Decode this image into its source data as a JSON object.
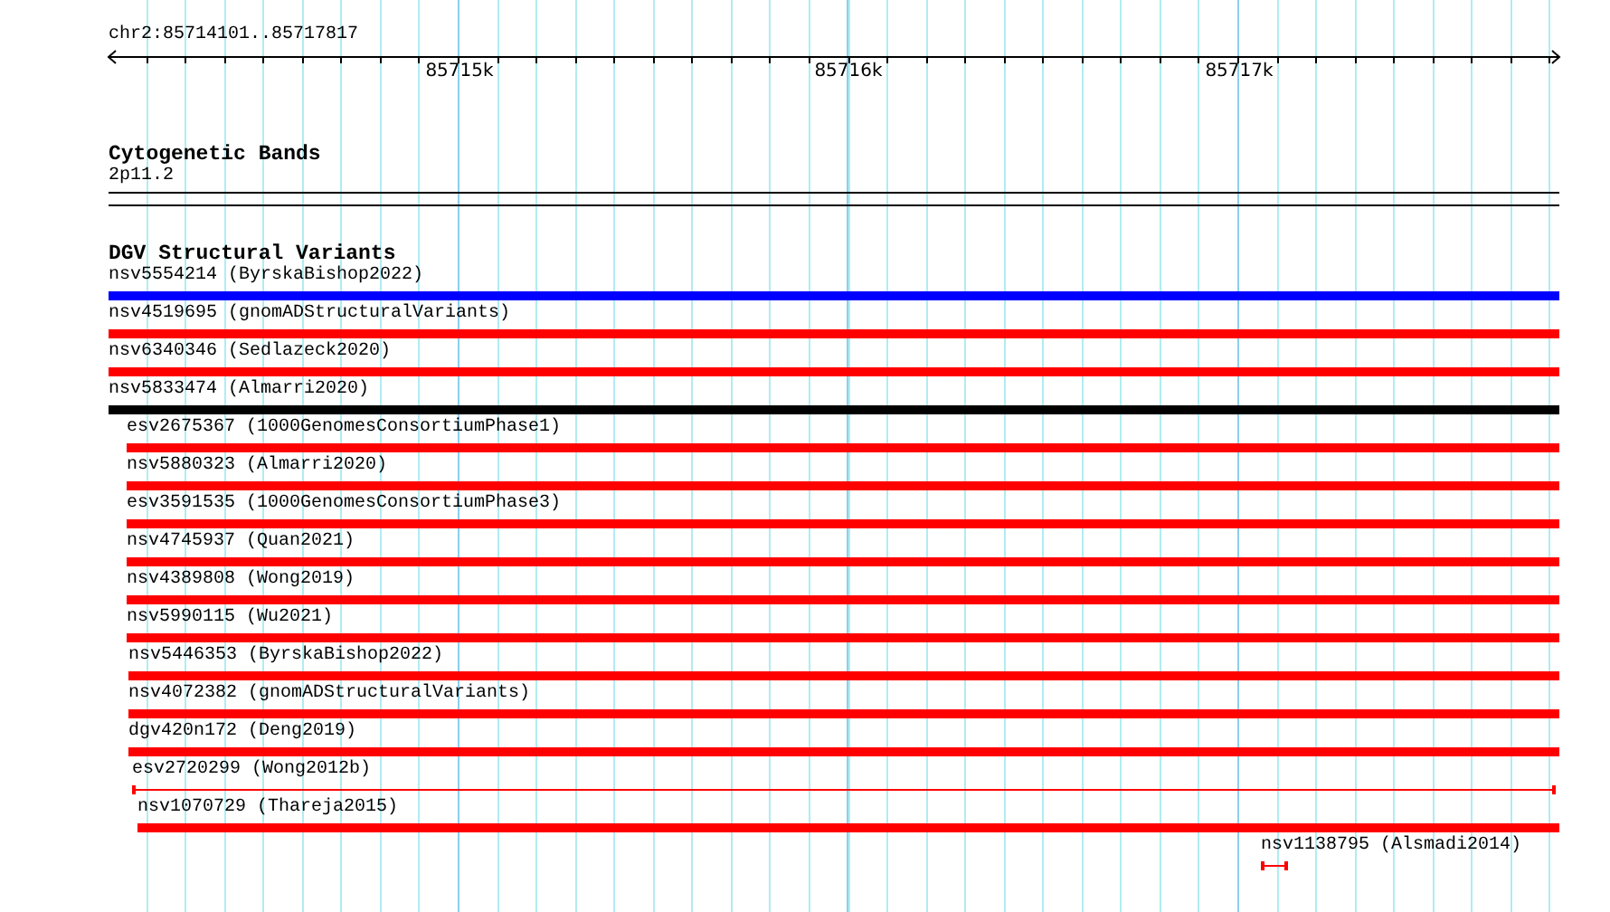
{
  "location": "chr2:85714101..85717817",
  "ruler": {
    "ticks": [
      "85715k",
      "85716k",
      "85717k"
    ]
  },
  "cytoband_track": {
    "title": "Cytogenetic Bands",
    "band": "2p11.2"
  },
  "variant_track": {
    "title": "DGV Structural Variants",
    "features": [
      {
        "label": "nsv5554214 (ByrskaBishop2022)",
        "color": "#0000ff",
        "kind": "bar"
      },
      {
        "label": "nsv4519695 (gnomADStructuralVariants)",
        "color": "#ff0000",
        "kind": "bar"
      },
      {
        "label": "nsv6340346 (Sedlazeck2020)",
        "color": "#ff0000",
        "kind": "bar"
      },
      {
        "label": "nsv5833474 (Almarri2020)",
        "color": "#000000",
        "kind": "bar"
      },
      {
        "label": "esv2675367 (1000GenomesConsortiumPhase1)",
        "color": "#ff0000",
        "kind": "bar"
      },
      {
        "label": "nsv5880323 (Almarri2020)",
        "color": "#ff0000",
        "kind": "bar"
      },
      {
        "label": "esv3591535 (1000GenomesConsortiumPhase3)",
        "color": "#ff0000",
        "kind": "bar"
      },
      {
        "label": "nsv4745937 (Quan2021)",
        "color": "#ff0000",
        "kind": "bar"
      },
      {
        "label": "nsv4389808 (Wong2019)",
        "color": "#ff0000",
        "kind": "bar"
      },
      {
        "label": "nsv5990115 (Wu2021)",
        "color": "#ff0000",
        "kind": "bar"
      },
      {
        "label": "nsv5446353 (ByrskaBishop2022)",
        "color": "#ff0000",
        "kind": "bar"
      },
      {
        "label": "nsv4072382 (gnomADStructuralVariants)",
        "color": "#ff0000",
        "kind": "bar"
      },
      {
        "label": "dgv420n172 (Deng2019)",
        "color": "#ff0000",
        "kind": "bar"
      },
      {
        "label": "esv2720299 (Wong2012b)",
        "color": "#ff0000",
        "kind": "line"
      },
      {
        "label": "nsv1070729 (Thareja2015)",
        "color": "#ff0000",
        "kind": "bar"
      },
      {
        "label": "nsv1138795 (Alsmadi2014)",
        "color": "#ff0000",
        "kind": "line"
      }
    ]
  }
}
